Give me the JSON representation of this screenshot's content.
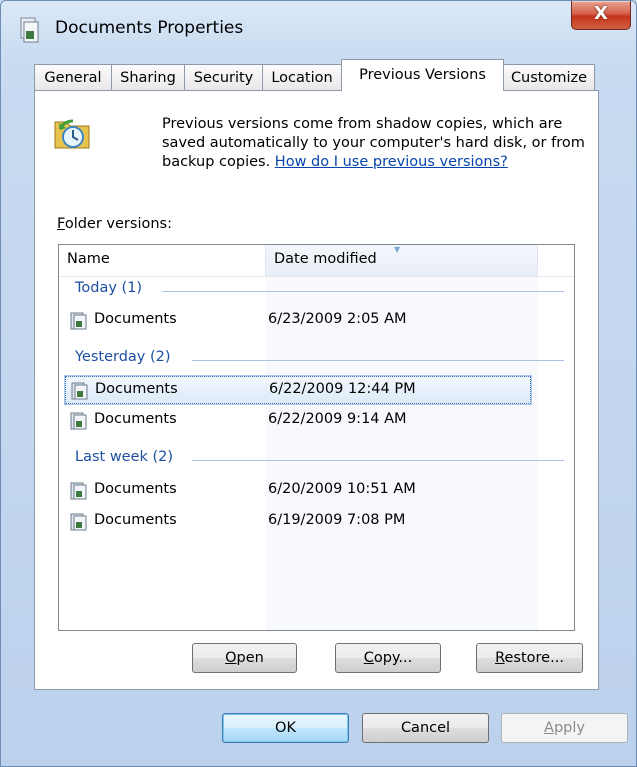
{
  "window": {
    "title": "Documents Properties",
    "close_label": "X"
  },
  "tabs": [
    {
      "label": "General",
      "active": false
    },
    {
      "label": "Sharing",
      "active": false
    },
    {
      "label": "Security",
      "active": false
    },
    {
      "label": "Location",
      "active": false
    },
    {
      "label": "Previous Versions",
      "active": true
    },
    {
      "label": "Customize",
      "active": false
    }
  ],
  "info": {
    "text": "Previous versions come from shadow copies, which are saved automatically to your computer's hard disk, or from backup copies.",
    "link": "How do I use previous versions?"
  },
  "folder_versions": {
    "label_accel": "F",
    "label_rest": "older versions:"
  },
  "columns": {
    "name": "Name",
    "date": "Date modified"
  },
  "groups": [
    {
      "label": "Today (1)",
      "items": [
        {
          "name": "Documents",
          "date": "6/23/2009 2:05 AM",
          "selected": false
        }
      ]
    },
    {
      "label": "Yesterday (2)",
      "items": [
        {
          "name": "Documents",
          "date": "6/22/2009 12:44 PM",
          "selected": true
        },
        {
          "name": "Documents",
          "date": "6/22/2009 9:14 AM",
          "selected": false
        }
      ]
    },
    {
      "label": "Last week (2)",
      "items": [
        {
          "name": "Documents",
          "date": "6/20/2009 10:51 AM",
          "selected": false
        },
        {
          "name": "Documents",
          "date": "6/19/2009 7:08 PM",
          "selected": false
        }
      ]
    }
  ],
  "actions": {
    "open": {
      "accel": "O",
      "rest": "pen"
    },
    "copy": {
      "accel": "C",
      "rest": "opy..."
    },
    "restore": {
      "accel": "R",
      "rest": "estore..."
    }
  },
  "dialog": {
    "ok": "OK",
    "cancel": "Cancel",
    "apply_accel": "A",
    "apply_rest": "pply"
  },
  "icons": {
    "chevron": "chevron-up-icon",
    "folder": "folder-icon",
    "restore": "restore-clock-icon"
  }
}
